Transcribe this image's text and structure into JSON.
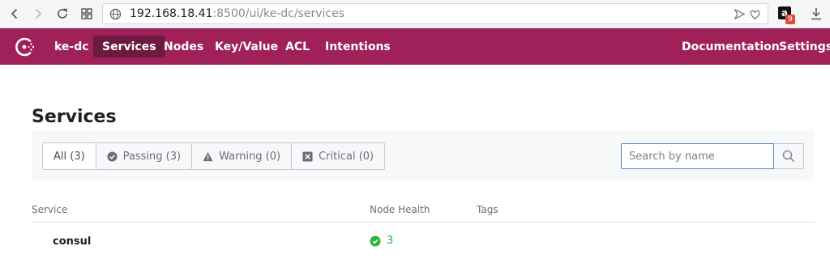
{
  "browser": {
    "url_host": "192.168.18.41",
    "url_rest": ":8500/ui/ke-dc/services",
    "extension_badge": "9",
    "extension_letter": "a"
  },
  "header": {
    "datacenter": "ke-dc",
    "nav": [
      {
        "label": "Services",
        "active": true
      },
      {
        "label": "Nodes"
      },
      {
        "label": "Key/Value"
      },
      {
        "label": "ACL"
      },
      {
        "label": "Intentions"
      }
    ],
    "right": [
      {
        "label": "Documentation"
      },
      {
        "label": "Settings"
      }
    ],
    "brand_color": "#a0215a",
    "active_color": "#6d1a3f"
  },
  "page": {
    "title": "Services"
  },
  "filters": [
    {
      "label": "All (3)",
      "selected": true,
      "icon": null
    },
    {
      "label": "Passing (3)",
      "icon": "check-circle-icon"
    },
    {
      "label": "Warning (0)",
      "icon": "warning-triangle-icon"
    },
    {
      "label": "Critical (0)",
      "icon": "x-square-icon"
    }
  ],
  "search": {
    "placeholder": "Search by name",
    "value": ""
  },
  "table": {
    "columns": [
      "Service",
      "Node Health",
      "Tags"
    ],
    "rows": [
      {
        "service": "consul",
        "health": "3",
        "health_status": "passing",
        "tags": ""
      }
    ]
  },
  "colors": {
    "passing": "#2eb039"
  }
}
